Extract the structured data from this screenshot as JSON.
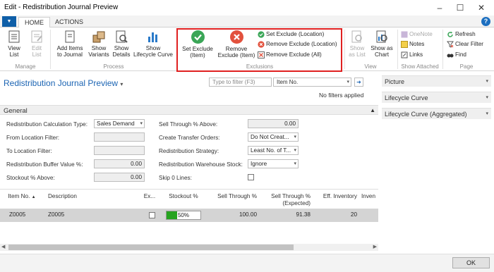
{
  "window": {
    "title": "Edit - Redistribution Journal Preview"
  },
  "tabs": [
    "HOME",
    "ACTIONS"
  ],
  "ribbon": {
    "manage": {
      "label": "Manage",
      "view_list": [
        "View",
        "List"
      ],
      "edit_list": [
        "Edit",
        "List"
      ]
    },
    "process": {
      "label": "Process",
      "add_items": [
        "Add Items",
        "to Journal"
      ],
      "show_variants": [
        "Show",
        "Variants"
      ],
      "show_details": [
        "Show",
        "Details"
      ],
      "show_lifecycle": [
        "Show",
        "Lifecycle Curve"
      ]
    },
    "exclusions": {
      "label": "Exclusions",
      "set_exclude_item": [
        "Set Exclude",
        "(Item)"
      ],
      "remove_exclude_item": [
        "Remove",
        "Exclude (Item)"
      ],
      "set_exclude_location": "Set Exclude (Location)",
      "remove_exclude_location": "Remove Exclude (Location)",
      "remove_exclude_all": "Remove Exclude (All)"
    },
    "view": {
      "label": "View",
      "show_as_list": [
        "Show",
        "as List"
      ],
      "show_as_chart": [
        "Show as",
        "Chart"
      ]
    },
    "show_attached": {
      "label": "Show Attached",
      "onenote": "OneNote",
      "notes": "Notes",
      "links": "Links"
    },
    "page": {
      "label": "Page",
      "refresh": "Refresh",
      "clear_filter": "Clear Filter",
      "find": "Find"
    }
  },
  "page": {
    "title": "Redistribution Journal Preview",
    "filter_placeholder": "Type to filter (F3)",
    "filter_field": "Item No.",
    "no_filters": "No filters applied"
  },
  "general": {
    "header": "General",
    "left": [
      {
        "label": "Redistribution Calculation Type:",
        "value": "Sales Demand"
      },
      {
        "label": "From Location Filter:",
        "value": ""
      },
      {
        "label": "To Location Filter:",
        "value": ""
      },
      {
        "label": "Redistribution Buffer Value %:",
        "value": "0.00"
      },
      {
        "label": "Stockout % Above:",
        "value": "0.00"
      }
    ],
    "right": [
      {
        "label": "Sell Through % Above:",
        "value": "0.00"
      },
      {
        "label": "Create Transfer Orders:",
        "value": "Do Not Creat..."
      },
      {
        "label": "Redistribution Strategy:",
        "value": "Least No. of T..."
      },
      {
        "label": "Redistribution Warehouse Stock:",
        "value": "Ignore"
      },
      {
        "label": "Skip 0 Lines:",
        "value": ""
      }
    ]
  },
  "grid": {
    "columns": [
      "Item No.",
      "Description",
      "Ex...",
      "Stockout %",
      "Sell Through %",
      "Sell Through %",
      "(Expected)",
      "Eff. Inventory",
      "Inven"
    ],
    "rows": [
      {
        "item_no": "Z0005",
        "description": "Z0005",
        "excluded": false,
        "stockout": "50%",
        "stockout_fraction": 0.5,
        "sell_through": "100.00",
        "sell_through_expected": "91.38",
        "eff_inventory": "20"
      }
    ]
  },
  "factboxes": [
    "Picture",
    "Lifecycle Curve",
    "Lifecycle Curve (Aggregated)"
  ],
  "footer": {
    "ok": "OK"
  },
  "colors": {
    "accent": "#1b64b3",
    "highlight_frame": "#e02020",
    "progress": "#26a31f"
  }
}
